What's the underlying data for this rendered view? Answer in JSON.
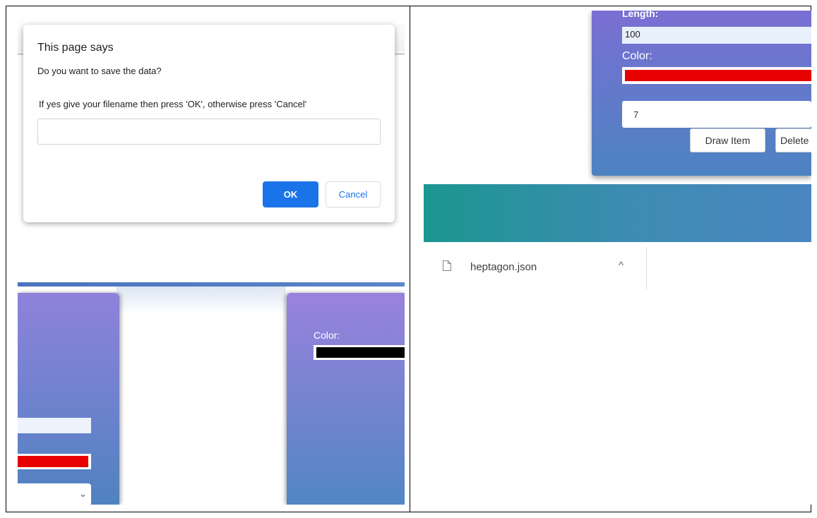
{
  "dialog": {
    "title": "This page says",
    "message": "Do you want to save the data?",
    "instructions": "If yes give your filename then press 'OK', otherwise press 'Cancel'",
    "input_value": "",
    "ok_label": "OK",
    "cancel_label": "Cancel"
  },
  "left_bottom": {
    "color_label": "Color:"
  },
  "right_form": {
    "length_label": "Length:",
    "length_value": "100",
    "color_label": "Color:",
    "sides_value": "7",
    "draw_button": "Draw Item",
    "delete_button": "Delete"
  },
  "download_bar": {
    "filename": "heptagon.json",
    "caret": "^"
  },
  "colors": {
    "primary_button": "#1a73e8",
    "card_gradient_top": "#8f82dc",
    "card_gradient_bottom": "#4f82c0",
    "teal_band": "#1b9690",
    "red_swatch": "#e60000",
    "black_swatch": "#000000"
  }
}
